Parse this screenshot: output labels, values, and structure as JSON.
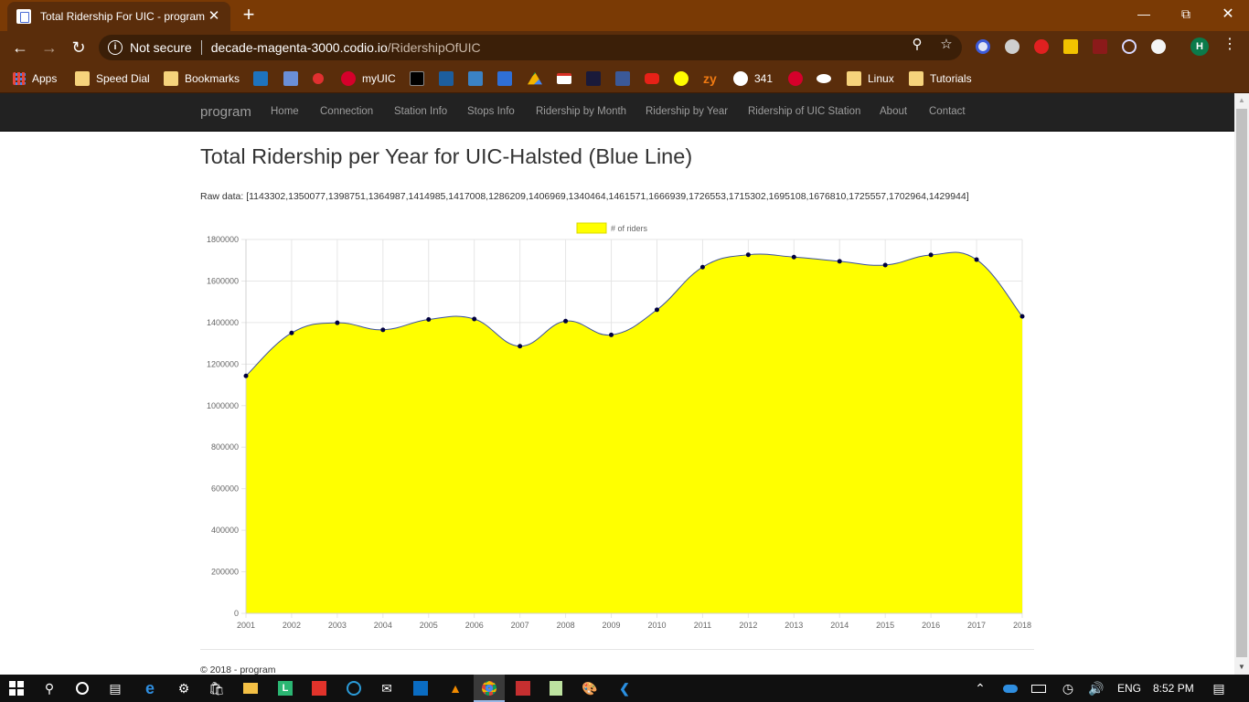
{
  "browser": {
    "tab_title": "Total Ridership For UIC - program",
    "address_security": "Not secure",
    "address_host": "decade-magenta-3000.codio.io",
    "address_path": "/RidershipOfUIC",
    "profile_initial": "H",
    "bookmarks": [
      {
        "label": "Apps",
        "icon": "apps-grid-icon"
      },
      {
        "label": "Speed Dial",
        "icon": "folder-icon"
      },
      {
        "label": "Bookmarks",
        "icon": "folder-icon"
      },
      {
        "label": "",
        "icon": "box-icon"
      },
      {
        "label": "",
        "icon": "docs-icon"
      },
      {
        "label": "",
        "icon": "red-circle-icon"
      },
      {
        "label": "myUIC",
        "icon": "uic-icon"
      },
      {
        "label": "",
        "icon": "blackboard-icon"
      },
      {
        "label": "",
        "icon": "ic-icon"
      },
      {
        "label": "",
        "icon": "p-icon"
      },
      {
        "label": "",
        "icon": "c-icon"
      },
      {
        "label": "",
        "icon": "drive-icon"
      },
      {
        "label": "",
        "icon": "gmail-icon"
      },
      {
        "label": "",
        "icon": "v-icon"
      },
      {
        "label": "",
        "icon": "facebook-icon"
      },
      {
        "label": "",
        "icon": "youtube-icon"
      },
      {
        "label": "",
        "icon": "snapchat-icon"
      },
      {
        "label": "zy",
        "icon": "zybooks-icon"
      },
      {
        "label": "341",
        "icon": "globe-icon"
      },
      {
        "label": "",
        "icon": "uic-icon"
      },
      {
        "label": "",
        "icon": "uic-text-icon"
      },
      {
        "label": "Linux",
        "icon": "folder-icon"
      },
      {
        "label": "Tutorials",
        "icon": "folder-icon"
      }
    ]
  },
  "site": {
    "brand": "program",
    "nav": [
      "Home",
      "Connection",
      "Station Info",
      "Stops Info",
      "Ridership by Month",
      "Ridership by Year",
      "Ridership of UIC Station",
      "About",
      "Contact"
    ],
    "title": "Total Ridership per Year for UIC-Halsted (Blue Line)",
    "raw_data": "Raw data: [1143302,1350077,1398751,1364987,1414985,1417008,1286209,1406969,1340464,1461571,1666939,1726553,1715302,1695108,1676810,1725557,1702964,1429944]",
    "footer": "© 2018 - program"
  },
  "chart_data": {
    "type": "area",
    "categories": [
      "2001",
      "2002",
      "2003",
      "2004",
      "2005",
      "2006",
      "2007",
      "2008",
      "2009",
      "2010",
      "2011",
      "2012",
      "2013",
      "2014",
      "2015",
      "2016",
      "2017",
      "2018"
    ],
    "series": [
      {
        "name": "# of riders",
        "values": [
          1143302,
          1350077,
          1398751,
          1364987,
          1414985,
          1417008,
          1286209,
          1406969,
          1340464,
          1461571,
          1666939,
          1726553,
          1715302,
          1695108,
          1676810,
          1725557,
          1702964,
          1429944
        ]
      }
    ],
    "ylim": [
      0,
      1800000
    ],
    "yticks": [
      "0",
      "200000",
      "400000",
      "600000",
      "800000",
      "1000000",
      "1200000",
      "1400000",
      "1600000",
      "1800000"
    ],
    "legend_position": "top",
    "grid": true,
    "colors": {
      "fill": "#ffff00",
      "line": "#3a4fa0",
      "point": "#000040"
    }
  },
  "taskbar": {
    "language": "ENG",
    "time": "8:52 PM"
  }
}
